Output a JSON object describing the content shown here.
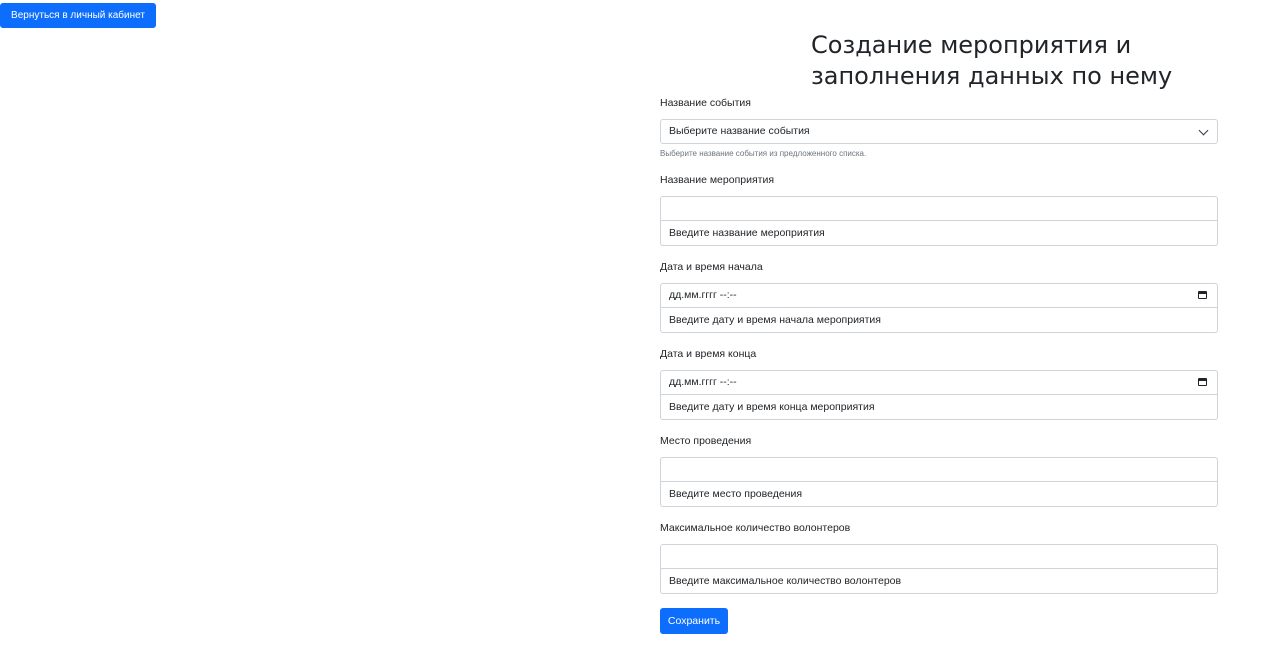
{
  "header": {
    "back_button_label": "Вернуться в личный кабинет",
    "page_title": "Создание мероприятия и заполнения данных по нему"
  },
  "form": {
    "event_type": {
      "label": "Название события",
      "selected": "Выберите название события",
      "help": "Выберите название события из предложенного списка."
    },
    "event_name": {
      "label": "Название мероприятия",
      "value": "",
      "hint": "Введите название мероприятия"
    },
    "start_datetime": {
      "label": "Дата и время начала",
      "value": "дд.мм.гггг --:--",
      "hint": "Введите дату и время начала мероприятия"
    },
    "end_datetime": {
      "label": "Дата и время конца",
      "value": "дд.мм.гггг --:--",
      "hint": "Введите дату и время конца мероприятия"
    },
    "location": {
      "label": "Место проведения",
      "value": "",
      "hint": "Введите место проведения"
    },
    "max_volunteers": {
      "label": "Максимальное количество волонтеров",
      "value": "",
      "hint": "Введите максимальное количество волонтеров"
    },
    "save_label": "Сохранить"
  },
  "colors": {
    "primary": "#0d6efd",
    "border": "#ced4da",
    "text": "#212529",
    "muted": "#6c757d"
  }
}
